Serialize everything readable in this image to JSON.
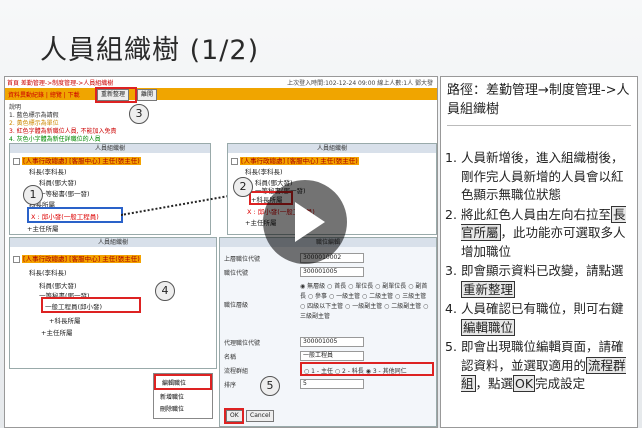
{
  "slide_title": "人員組織樹 (1/2)",
  "app": {
    "top_left": "首頁  差勤管理->制度管理->人員組織樹",
    "top_right": "上次登入時間:102-12-24 09:00   線上人數:1人   鄧大發",
    "crumb": "資料異動紀錄 | 總覽 | 下載",
    "btn_reorg": "重新整理",
    "btn_close": "離開",
    "legend_title": "說明",
    "legend": [
      "1. 藍色標示為請假",
      "2. 黃色標示為單位",
      "3. 紅色字體為新職位人員, 不能加入免責",
      "4. 灰色小字體為新任詳職位的人員"
    ]
  },
  "tree_top_left": {
    "header": "人員組織樹",
    "nodes": [
      "[人事行政總處] [客服中心] 主任(張主任)",
      "科長(李科長)",
      "科員(鄧大發)",
      "一等秘書(鄧一發)",
      "科長所屬",
      "X : 邱小發(一般工程員)",
      "+主任所屬"
    ]
  },
  "tree_top_right": {
    "header": "人員組織樹",
    "nodes": [
      "[人事行政總處] [客服中心] 主任(張主任)",
      "科長(李科長)",
      "科員(鄧大發)",
      "一等秘書(鄧一發)",
      "+科長所屬",
      "X : 邱小發(一般工程員)",
      "+主任所屬"
    ]
  },
  "tree_bottom": {
    "header": "人員組織樹",
    "nodes": [
      "[人事行政總處] [客服中心] 主任(張主任)",
      "科長(李科長)",
      "科員(鄧大發)",
      "一等秘書(鄧一發)",
      "一般工程員(邱小發)",
      "+科長所屬",
      "+主任所屬"
    ]
  },
  "context_menu": [
    "編輯職位",
    "新增職位",
    "刪除職位"
  ],
  "form": {
    "header": "職位編輯",
    "labels": [
      "上層職位代號",
      "職位代號",
      "職位層級",
      "代理職位代號",
      "名稱",
      "流程群組",
      "排序"
    ],
    "values": [
      "3000010002",
      "300001005",
      "",
      "300001005",
      "一般工程員",
      "",
      "5"
    ],
    "levels": "◉ 無層級 ○ 首長 ○ 單位長 ○ 副單位長 ○ 副首長 ○ 參事 ○ 一級主管 ○ 二級主管 ○ 三級主管 ○ 四級以下主管 ○ 一級副主管 ○ 二級副主管 ○ 三級副主管",
    "flow": "○ 1 - 主任  ○ 2 - 科長  ◉ 3 - 其他同仁",
    "ok": "OK",
    "cancel": "Cancel"
  },
  "badges": [
    "1",
    "2",
    "3",
    "4",
    "5"
  ],
  "right_panel": {
    "path": "路徑：差勤管理→制度管理->人員組織樹",
    "steps": [
      {
        "n": "1.",
        "t": "人員新增後，進入組織樹後，剛作完人員新增的人員會以紅色顯示無職位狀態"
      },
      {
        "n": "2.",
        "t": "將此紅色人員由左向右拉至",
        "hl": "長官所屬",
        "t2": "，此功能亦可選取多人增加職位"
      },
      {
        "n": "3.",
        "t": "即會顯示資料已改變，請點選",
        "hl": "重新整理",
        "t2": ""
      },
      {
        "n": "4.",
        "t": "人員確認已有職位，則可右鍵",
        "hl": "編輯職位",
        "t2": ""
      },
      {
        "n": "5.",
        "t": "即會出現職位編輯頁面，請確認資料，並選取適用的",
        "hl": "流程群組",
        "t2": "，點選",
        "hl2": "OK",
        "t3": "完成設定"
      }
    ]
  },
  "colors": {
    "accent": "#f0a500",
    "highlight_red": "#d22222",
    "highlight_blue": "#2a62c9"
  }
}
